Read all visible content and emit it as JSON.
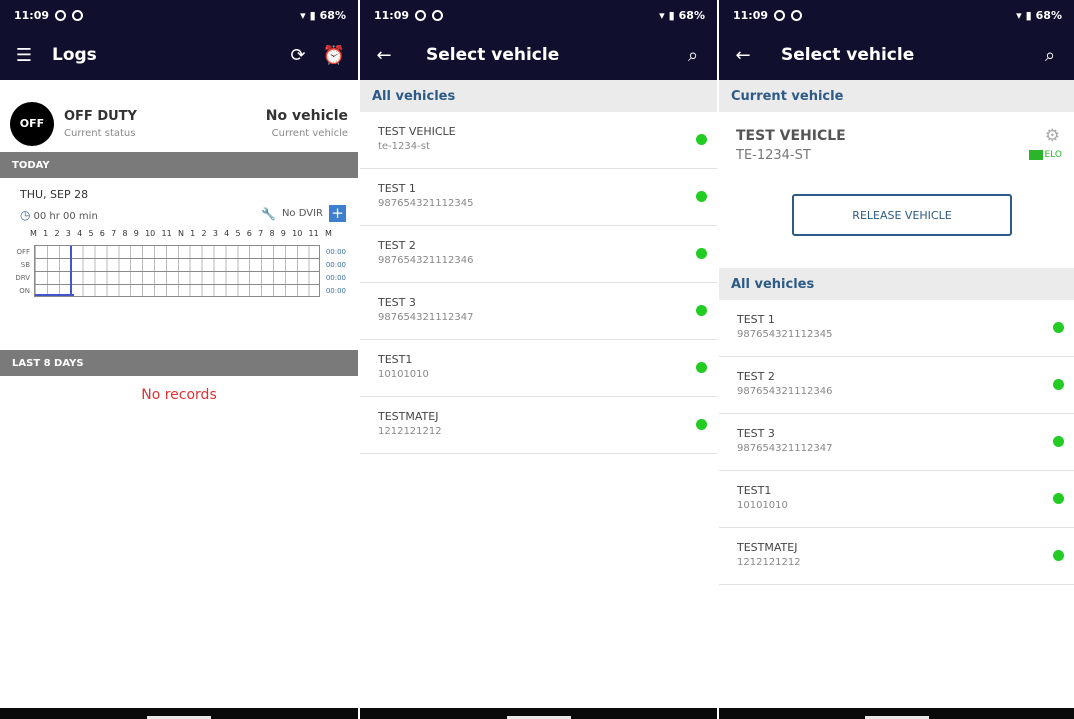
{
  "status": {
    "time": "11:09",
    "battery": "68%"
  },
  "logs_screen": {
    "title": "Logs",
    "duty_status": "OFF DUTY",
    "duty_badge": "OFF",
    "duty_sub": "Current status",
    "vehicle": "No vehicle",
    "vehicle_sub": "Current vehicle",
    "today_header": "TODAY",
    "date": "THU, SEP 28",
    "duration": "00 hr 00 min",
    "dvir": "No DVIR",
    "hour_labels": [
      "M",
      "1",
      "2",
      "3",
      "4",
      "5",
      "6",
      "7",
      "8",
      "9",
      "10",
      "11",
      "N",
      "1",
      "2",
      "3",
      "4",
      "5",
      "6",
      "7",
      "8",
      "9",
      "10",
      "11",
      "M"
    ],
    "grid_rows": [
      "OFF",
      "SB",
      "DRV",
      "ON"
    ],
    "grid_totals": [
      "00:00",
      "00:00",
      "00:00",
      "00:00"
    ],
    "last_days_header": "LAST 8 DAYS",
    "no_records": "No records"
  },
  "select_screen": {
    "title": "Select vehicle",
    "all_header": "All vehicles",
    "vehicles": [
      {
        "name": "TEST VEHICLE",
        "number": "te-1234-st"
      },
      {
        "name": "TEST 1",
        "number": "987654321112345"
      },
      {
        "name": "TEST 2",
        "number": "987654321112346"
      },
      {
        "name": "TEST 3",
        "number": "987654321112347"
      },
      {
        "name": "TEST1",
        "number": "10101010"
      },
      {
        "name": "TESTMATEJ",
        "number": "1212121212"
      }
    ]
  },
  "current_screen": {
    "title": "Select vehicle",
    "current_header": "Current vehicle",
    "current_name": "TEST VEHICLE",
    "current_number": "TE-1234-ST",
    "elo_label": "ELO",
    "release_label": "RELEASE VEHICLE",
    "all_header": "All vehicles",
    "vehicles": [
      {
        "name": "TEST 1",
        "number": "987654321112345"
      },
      {
        "name": "TEST 2",
        "number": "987654321112346"
      },
      {
        "name": "TEST 3",
        "number": "987654321112347"
      },
      {
        "name": "TEST1",
        "number": "10101010"
      },
      {
        "name": "TESTMATEJ",
        "number": "1212121212"
      }
    ]
  },
  "colors": {
    "appbar": "#10102e",
    "accent": "#2d5a86",
    "online": "#22cc22",
    "error": "#dd3333"
  }
}
